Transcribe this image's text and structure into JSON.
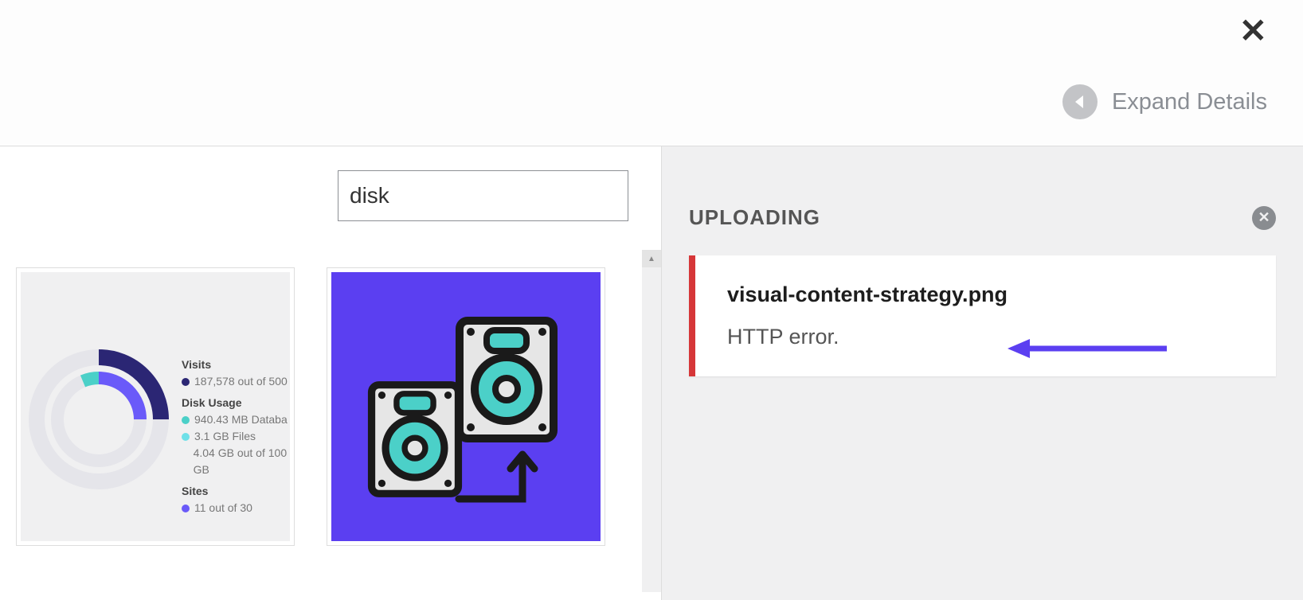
{
  "header": {
    "expand_label": "Expand Details"
  },
  "search": {
    "value": "disk"
  },
  "thumbs": {
    "stats": {
      "visits_label": "Visits",
      "visits_value": "187,578 out of 500",
      "disk_usage_label": "Disk Usage",
      "db_value": "940.43 MB Databa",
      "files_value": "3.1 GB Files",
      "total_value": "4.04 GB out of 100 GB",
      "sites_label": "Sites",
      "sites_value": "11 out of 30"
    }
  },
  "upload": {
    "heading": "UPLOADING",
    "filename": "visual-content-strategy.png",
    "error": "HTTP error."
  }
}
